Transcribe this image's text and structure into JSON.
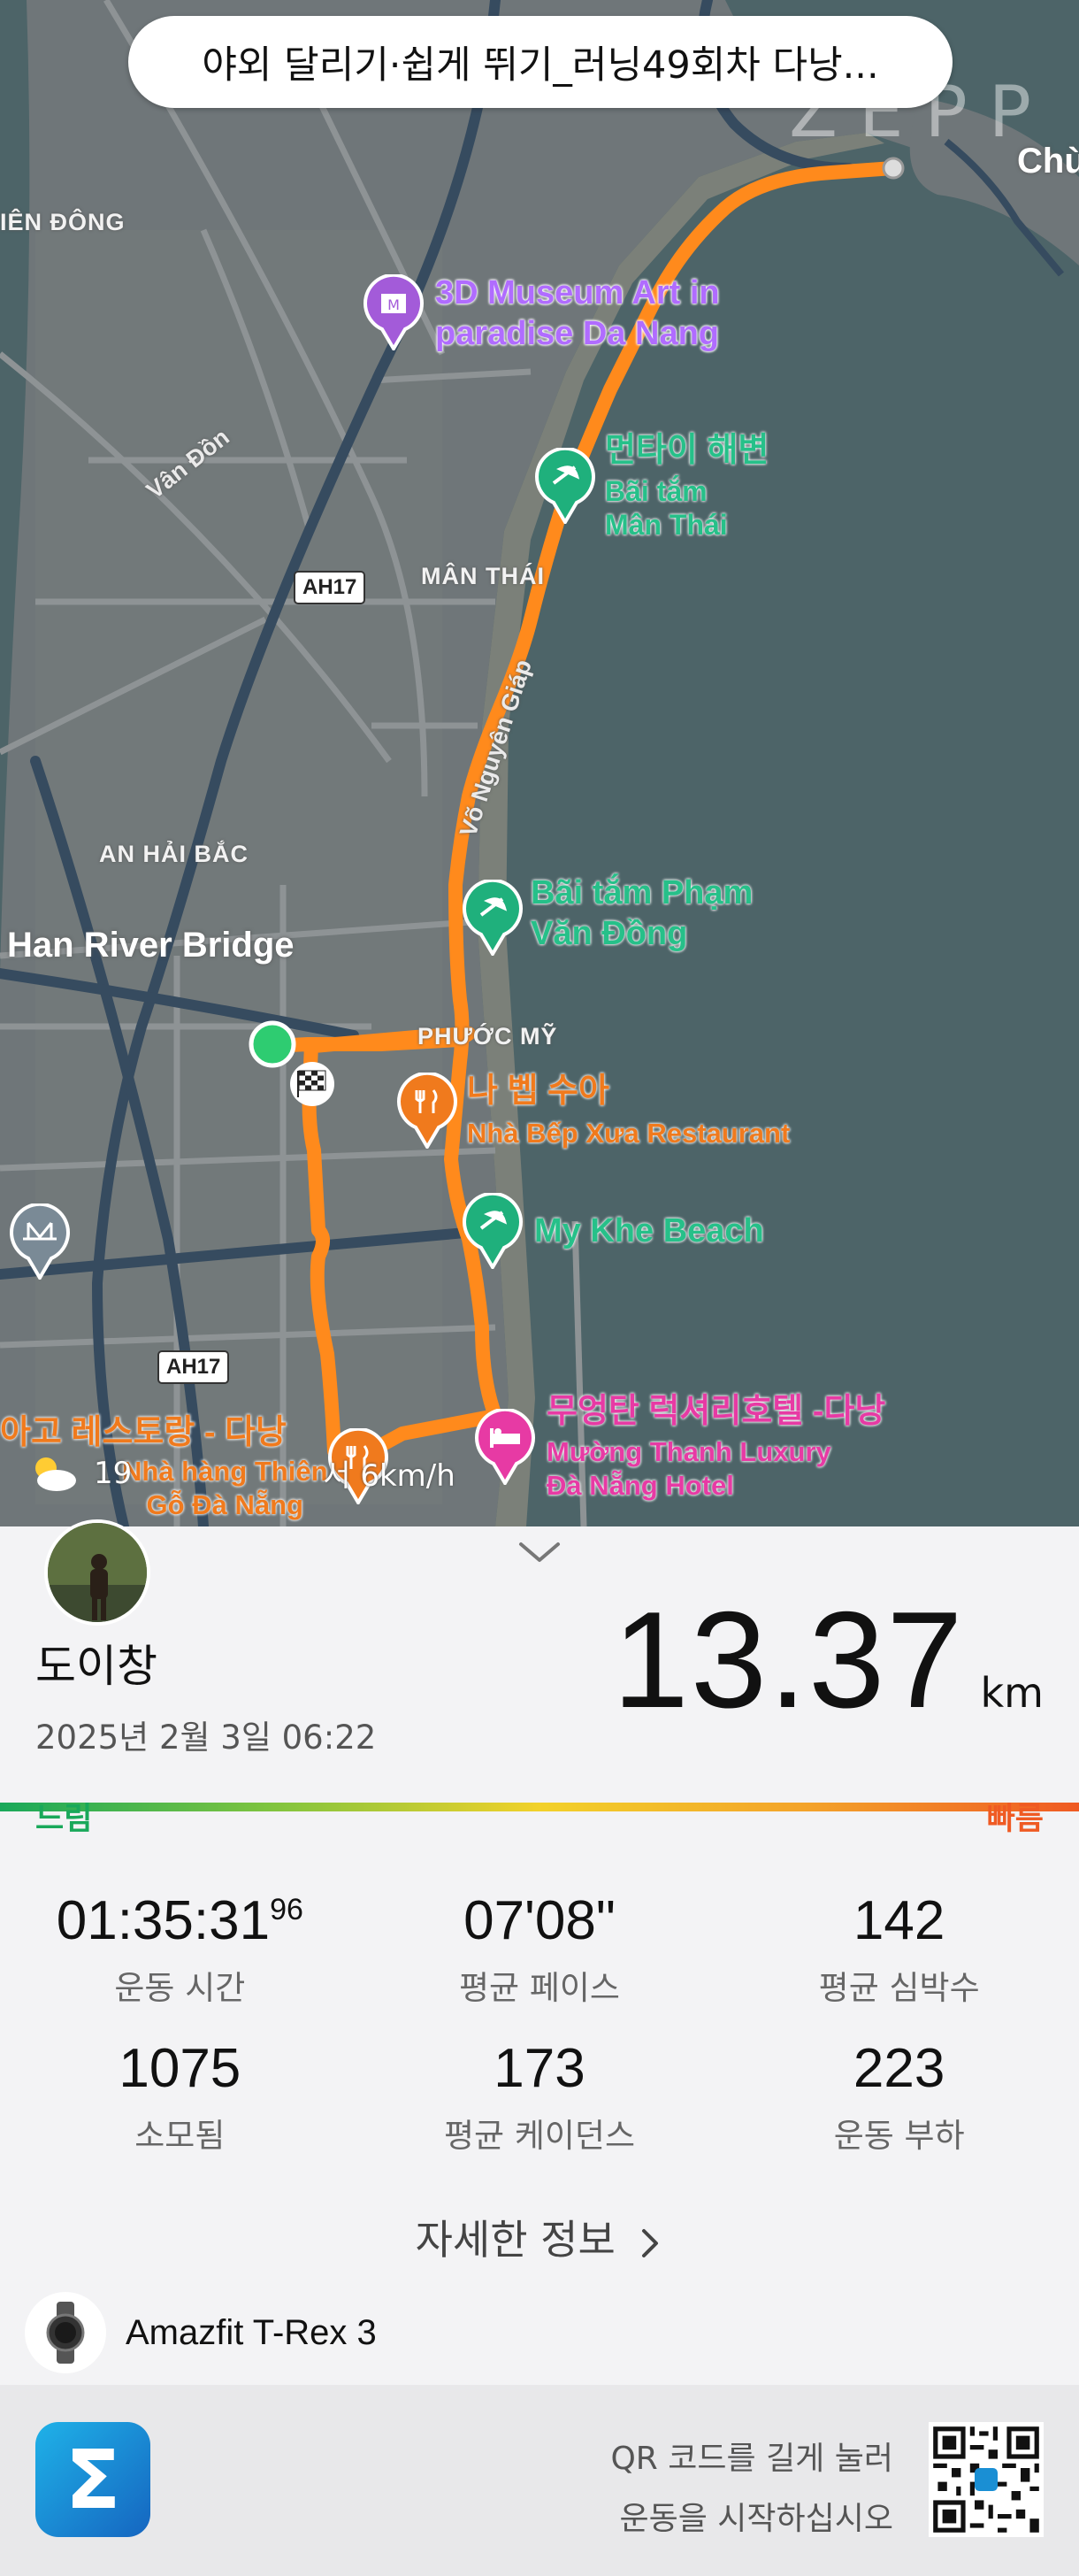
{
  "header": {
    "title": "야외 달리기·쉽게 뛰기_러닝49회차 다낭..."
  },
  "map": {
    "watermark": "ZEPP",
    "labels": {
      "area_chu": "Chù",
      "area_yen_dong": "IÊN ĐÔNG",
      "poi_museum": "3D Museum Art in\nparadise Da Nang",
      "poi_man_thai_ko": "먼타이 해변",
      "poi_man_thai_vi": "Bãi tắm\nMân Thái",
      "road_van_don": "Vân Đồn",
      "shield_ah17_a": "AH17",
      "area_man_thai": "MÂN THÁI",
      "road_vo_nguyen_giap": "Võ Nguyên Giáp",
      "area_an_hai_bac": "AN HẢI BẮC",
      "poi_pham_van_dong": "Bãi tắm Phạm\nVăn Đồng",
      "poi_han_river": "Han River Bridge",
      "area_phuoc_my": "PHƯỚC MỸ",
      "poi_nha_bep_ko": "나 벱 수아",
      "poi_nha_bep_vi": "Nhà Bếp Xưa Restaurant",
      "poi_my_khe": "My Khe Beach",
      "shield_ah17_b": "AH17",
      "poi_hotel_ko": "무엉탄 럭셔리호텔 -다낭",
      "poi_hotel_vi": "Mường Thanh Luxury\nĐà Nẵng Hotel",
      "poi_restaurant_ko": "아고 레스토랑 - 다낭",
      "poi_restaurant_vi": "Nhà hàng Thiên\nGỗ Đà Nẵng"
    },
    "weather": {
      "temp": "19",
      "wind": "서 6km/h"
    }
  },
  "workout": {
    "user_name": "도이창",
    "date": "2025년 2월 3일 06:22",
    "distance": "13.37",
    "distance_unit": "km",
    "speed_slow": "느림",
    "speed_fast": "빠름",
    "stats": [
      {
        "value": "01:35:31",
        "sup": "96",
        "label": "운동 시간"
      },
      {
        "value": "07'08\"",
        "sup": "",
        "label": "평균 페이스"
      },
      {
        "value": "142",
        "sup": "",
        "label": "평균 심박수"
      },
      {
        "value": "1075",
        "sup": "",
        "label": "소모됨"
      },
      {
        "value": "173",
        "sup": "",
        "label": "평균 케이던스"
      },
      {
        "value": "223",
        "sup": "",
        "label": "운동 부하"
      }
    ],
    "detail_label": "자세한 정보",
    "device_name": "Amazfit T-Rex 3"
  },
  "footer": {
    "app_icon": "zepp-sigma-icon",
    "qr_line1": "QR 코드를 길게 눌러",
    "qr_line2": "운동을 시작하십시오"
  },
  "colors": {
    "route": "#ff8a1c",
    "sea": "#4f6a6f",
    "land": "#6b7476"
  }
}
